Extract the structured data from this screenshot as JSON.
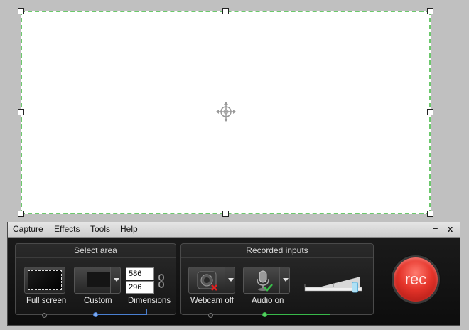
{
  "menu": {
    "items": [
      {
        "key": "capture",
        "label": "Capture"
      },
      {
        "key": "effects",
        "label": "Effects"
      },
      {
        "key": "tools",
        "label": "Tools"
      },
      {
        "key": "help",
        "label": "Help"
      }
    ],
    "minimize_label": "–",
    "close_label": "x"
  },
  "select_area": {
    "title": "Select area",
    "full_screen_label": "Full screen",
    "custom_label": "Custom",
    "dimensions_label": "Dimensions",
    "width": "586",
    "height": "296"
  },
  "recorded_inputs": {
    "title": "Recorded inputs",
    "webcam_label": "Webcam off",
    "audio_label": "Audio on",
    "volume_level": 0.95
  },
  "rec_label": "rec",
  "colors": {
    "capture_border": "#6cc86c",
    "rec_red": "#e5342a",
    "track_blue": "#4a7fd0",
    "track_green": "#38b84a"
  },
  "icons": {
    "crosshair": "move-crosshair-icon",
    "webcam": "webcam-icon",
    "microphone": "microphone-icon",
    "link": "chain-link-icon"
  }
}
